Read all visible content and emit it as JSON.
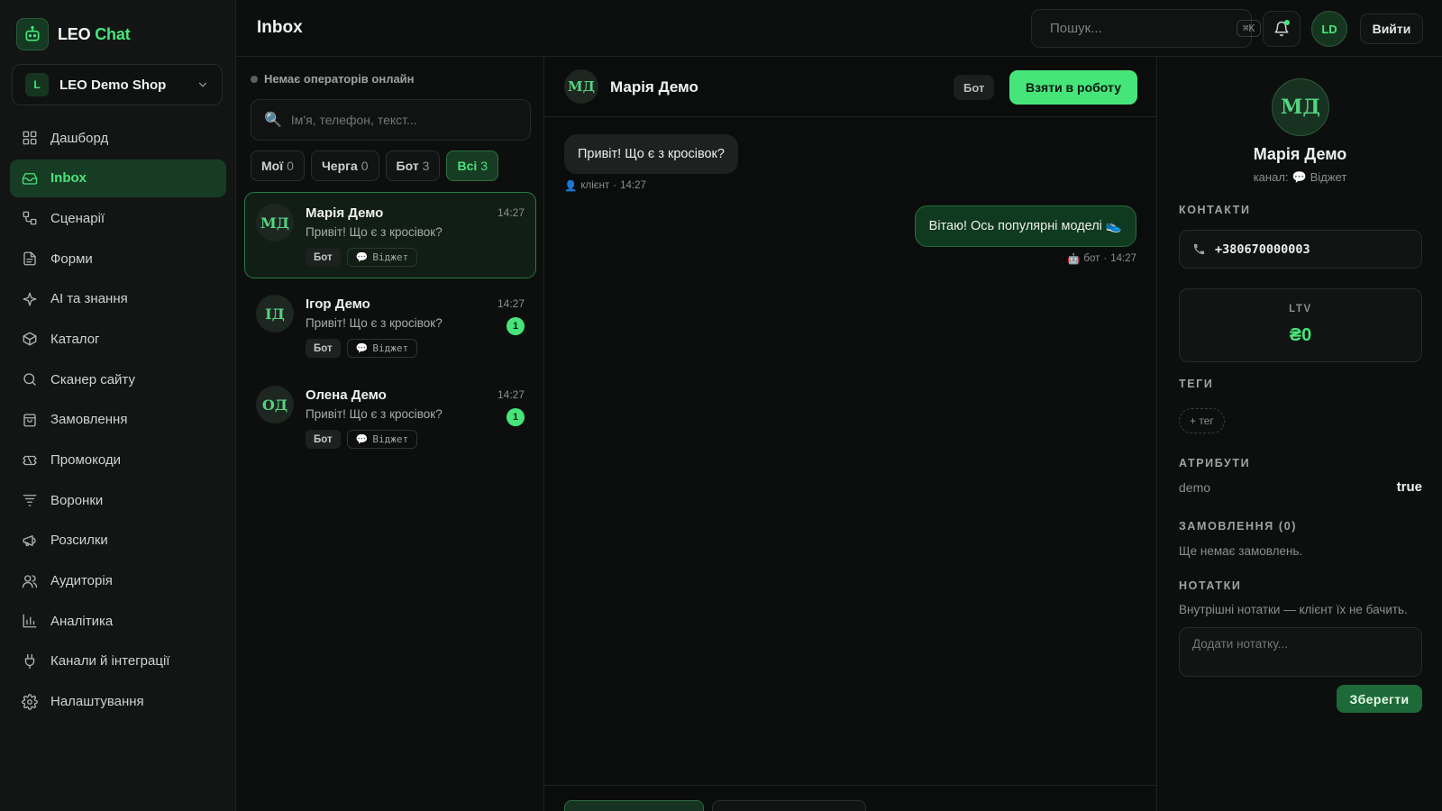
{
  "brand": {
    "name_part1": "LEO",
    "name_part2": "Chat"
  },
  "shop": {
    "avatar": "L",
    "name": "LEO Demo Shop"
  },
  "nav": [
    {
      "label": "Дашборд",
      "icon": "dashboard-icon",
      "active": false
    },
    {
      "label": "Inbox",
      "icon": "inbox-icon",
      "active": true
    },
    {
      "label": "Сценарії",
      "icon": "scenarios-icon",
      "active": false
    },
    {
      "label": "Форми",
      "icon": "forms-icon",
      "active": false
    },
    {
      "label": "AI та знання",
      "icon": "sparkle-icon",
      "active": false
    },
    {
      "label": "Каталог",
      "icon": "box-icon",
      "active": false
    },
    {
      "label": "Сканер сайту",
      "icon": "search-icon",
      "active": false
    },
    {
      "label": "Замовлення",
      "icon": "bag-icon",
      "active": false
    },
    {
      "label": "Промокоди",
      "icon": "ticket-icon",
      "active": false
    },
    {
      "label": "Воронки",
      "icon": "filter-icon",
      "active": false
    },
    {
      "label": "Розсилки",
      "icon": "megaphone-icon",
      "active": false
    },
    {
      "label": "Аудиторія",
      "icon": "users-icon",
      "active": false
    },
    {
      "label": "Аналітика",
      "icon": "chart-icon",
      "active": false
    },
    {
      "label": "Канали й інтеграції",
      "icon": "plug-icon",
      "active": false
    },
    {
      "label": "Налаштування",
      "icon": "gear-icon",
      "active": false
    }
  ],
  "topbar": {
    "title": "Inbox",
    "search_placeholder": "Пошук...",
    "search_shortcut": "⌘K",
    "user_initials": "LD",
    "logout_label": "Вийти"
  },
  "inbox": {
    "ops_status": "Немає операторів онлайн",
    "search_placeholder": "Ім'я, телефон, текст...",
    "filters": [
      {
        "label": "Мої",
        "count": "0",
        "active": false
      },
      {
        "label": "Черга",
        "count": "0",
        "active": false
      },
      {
        "label": "Бот",
        "count": "3",
        "active": false
      },
      {
        "label": "Всі",
        "count": "3",
        "active": true
      }
    ],
    "conversations": [
      {
        "initials": "МД",
        "name": "Марія Демо",
        "time": "14:27",
        "preview": "Привіт! Що є з кросівок?",
        "unread": "",
        "mode": "Бот",
        "channel": "Віджет",
        "active": true
      },
      {
        "initials": "ІД",
        "name": "Ігор Демо",
        "time": "14:27",
        "preview": "Привіт! Що є з кросівок?",
        "unread": "1",
        "mode": "Бот",
        "channel": "Віджет",
        "active": false
      },
      {
        "initials": "ОД",
        "name": "Олена Демо",
        "time": "14:27",
        "preview": "Привіт! Що є з кросівок?",
        "unread": "1",
        "mode": "Бот",
        "channel": "Віджет",
        "active": false
      }
    ]
  },
  "chat": {
    "initials": "МД",
    "name": "Марія Демо",
    "mode_badge": "Бот",
    "take_button": "Взяти в роботу",
    "messages": [
      {
        "direction": "in",
        "text": "Привіт! Що є з кросівок?",
        "sender_icon": "👤",
        "sender": "клієнт",
        "time": "14:27"
      },
      {
        "direction": "out",
        "text": "Вітаю! Ось популярні моделі 👟",
        "sender_icon": "🤖",
        "sender": "бот",
        "time": "14:27"
      }
    ]
  },
  "profile": {
    "initials": "МД",
    "name": "Марія Демо",
    "channel_prefix": "канал:",
    "channel_icon": "💬",
    "channel": "Віджет",
    "contacts_title": "КОНТАКТИ",
    "phone": "+380670000003",
    "ltv_label": "LTV",
    "ltv_value": "₴0",
    "tags_title": "ТЕГИ",
    "add_tag": "+ тег",
    "attributes_title": "АТРИБУТИ",
    "attributes": [
      {
        "key": "demo",
        "value": "true"
      }
    ],
    "orders_title": "ЗАМОВЛЕННЯ (0)",
    "orders_empty": "Ще немає замовлень.",
    "notes_title": "НОТАТКИ",
    "notes_hint": "Внутрішні нотатки — клієнт їх не бачить.",
    "note_placeholder": "Додати нотатку...",
    "save_label": "Зберегти"
  },
  "colors": {
    "accent": "#46e57a",
    "background": "#0b0d0c",
    "panel": "#131514"
  }
}
